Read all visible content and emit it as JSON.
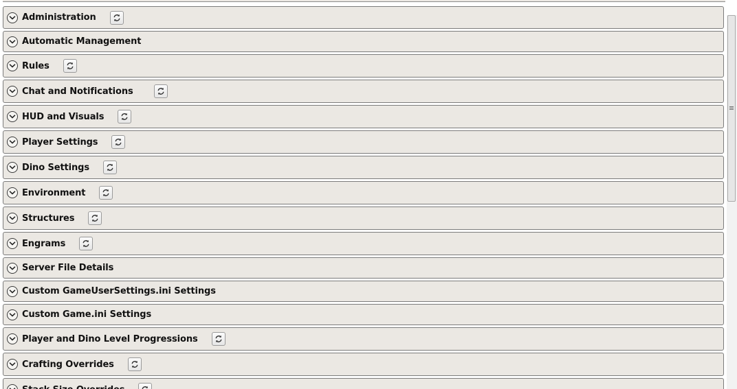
{
  "panels": [
    {
      "title": "Administration",
      "has_reset": true
    },
    {
      "title": "Automatic Management",
      "has_reset": false
    },
    {
      "title": "Rules",
      "has_reset": true
    },
    {
      "title": "Chat and Notifications",
      "has_reset": true
    },
    {
      "title": "HUD and Visuals",
      "has_reset": true
    },
    {
      "title": "Player Settings",
      "has_reset": true
    },
    {
      "title": "Dino Settings",
      "has_reset": true
    },
    {
      "title": "Environment",
      "has_reset": true
    },
    {
      "title": "Structures",
      "has_reset": true
    },
    {
      "title": "Engrams",
      "has_reset": true
    },
    {
      "title": "Server File Details",
      "has_reset": false
    },
    {
      "title": "Custom GameUserSettings.ini Settings",
      "has_reset": false
    },
    {
      "title": "Custom Game.ini Settings",
      "has_reset": false
    },
    {
      "title": "Player and Dino Level Progressions",
      "has_reset": true
    },
    {
      "title": "Crafting Overrides",
      "has_reset": true
    },
    {
      "title": "Stack Size Overrides",
      "has_reset": true
    }
  ],
  "icons": {
    "expander": "chevron-down-icon",
    "reset": "refresh-icon"
  },
  "scrollbar": {
    "visible_fraction": 0.5
  }
}
